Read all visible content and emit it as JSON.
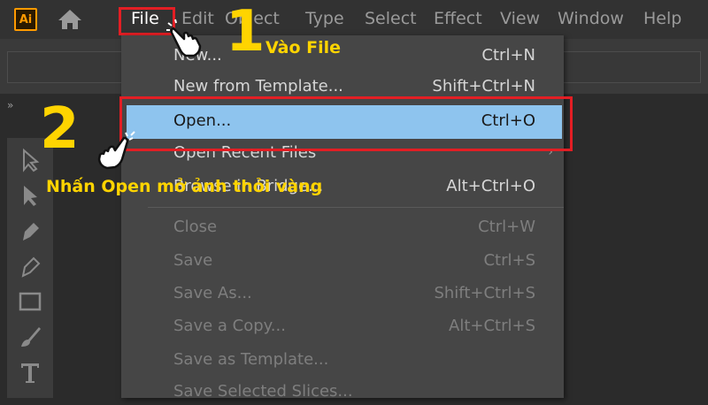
{
  "app": {
    "logo": "Ai"
  },
  "menubar": {
    "items": [
      "File",
      "Edit",
      "Object",
      "Type",
      "Select",
      "Effect",
      "View",
      "Window",
      "Help"
    ]
  },
  "file_menu": {
    "items": [
      {
        "label": "New...",
        "shortcut": "Ctrl+N",
        "enabled": true
      },
      {
        "label": "New from Template...",
        "shortcut": "Shift+Ctrl+N",
        "enabled": true
      },
      {
        "label": "Open...",
        "shortcut": "Ctrl+O",
        "enabled": true,
        "highlighted": true
      },
      {
        "label": "Open Recent Files",
        "shortcut": "",
        "enabled": true,
        "submenu": true
      },
      {
        "label": "Browse in Bridge...",
        "shortcut": "Alt+Ctrl+O",
        "enabled": true
      },
      {
        "label": "Close",
        "shortcut": "Ctrl+W",
        "enabled": false
      },
      {
        "label": "Save",
        "shortcut": "Ctrl+S",
        "enabled": false
      },
      {
        "label": "Save As...",
        "shortcut": "Shift+Ctrl+S",
        "enabled": false
      },
      {
        "label": "Save a Copy...",
        "shortcut": "Alt+Ctrl+S",
        "enabled": false
      },
      {
        "label": "Save as Template...",
        "shortcut": "",
        "enabled": false
      },
      {
        "label": "Save Selected Slices...",
        "shortcut": "",
        "enabled": false
      }
    ]
  },
  "annotations": {
    "step1_number": "1",
    "step1_text": "Vào File",
    "step2_number": "2",
    "step2_text": "Nhấn Open mở ảnh thỏi vàng"
  },
  "colors": {
    "highlight_box": "#e31e24",
    "annotation": "#ffd400",
    "selected_item": "#8ec4ee"
  }
}
